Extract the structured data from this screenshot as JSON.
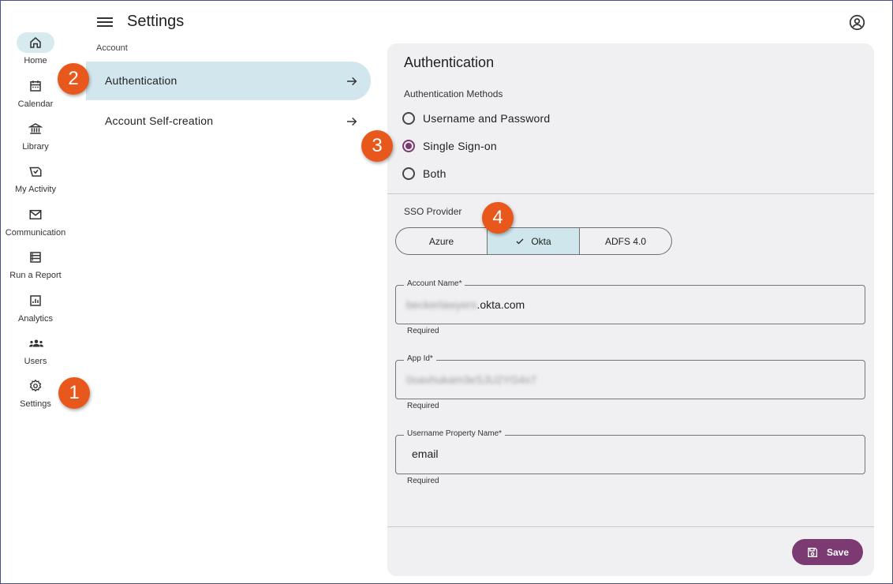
{
  "header": {
    "title": "Settings",
    "menu_icon": "hamburger-menu-icon",
    "account_icon": "account-circle-icon"
  },
  "rail": [
    {
      "label": "Home",
      "icon": "home-icon",
      "active": true
    },
    {
      "label": "Calendar",
      "icon": "calendar-icon"
    },
    {
      "label": "Library",
      "icon": "library-icon"
    },
    {
      "label": "My Activity",
      "icon": "activity-icon"
    },
    {
      "label": "Communication",
      "icon": "mail-icon"
    },
    {
      "label": "Run a Report",
      "icon": "report-icon"
    },
    {
      "label": "Analytics",
      "icon": "analytics-icon"
    },
    {
      "label": "Users",
      "icon": "users-icon"
    },
    {
      "label": "Settings",
      "icon": "gear-icon"
    }
  ],
  "account_nav": {
    "section_label": "Account",
    "items": [
      {
        "label": "Authentication",
        "active": true
      },
      {
        "label": "Account Self-creation"
      }
    ]
  },
  "panel": {
    "title": "Authentication",
    "methods_label": "Authentication Methods",
    "methods": [
      {
        "label": "Username and Password",
        "checked": false
      },
      {
        "label": "Single Sign-on",
        "checked": true
      },
      {
        "label": "Both",
        "checked": false
      }
    ],
    "sso_label": "SSO Provider",
    "providers": [
      {
        "label": "Azure"
      },
      {
        "label": "Okta",
        "selected": true
      },
      {
        "label": "ADFS 4.0"
      }
    ],
    "fields": [
      {
        "label": "Account Name*",
        "value_blurred": "beckerlawyers",
        "value_visible": ".okta.com",
        "helper": "Required"
      },
      {
        "label": "App Id*",
        "value_blurred": "0oavhukam3eSJU2YG4x7",
        "helper": "Required"
      },
      {
        "label": "Username Property Name*",
        "value": "email",
        "helper": "Required"
      }
    ],
    "save_label": "Save"
  },
  "callouts": [
    "1",
    "2",
    "3",
    "4"
  ],
  "colors": {
    "accent": "#7c3a72",
    "selected_bg": "#d1e7ed",
    "panel_bg": "#f0eff1",
    "callout": "#e8581c"
  }
}
